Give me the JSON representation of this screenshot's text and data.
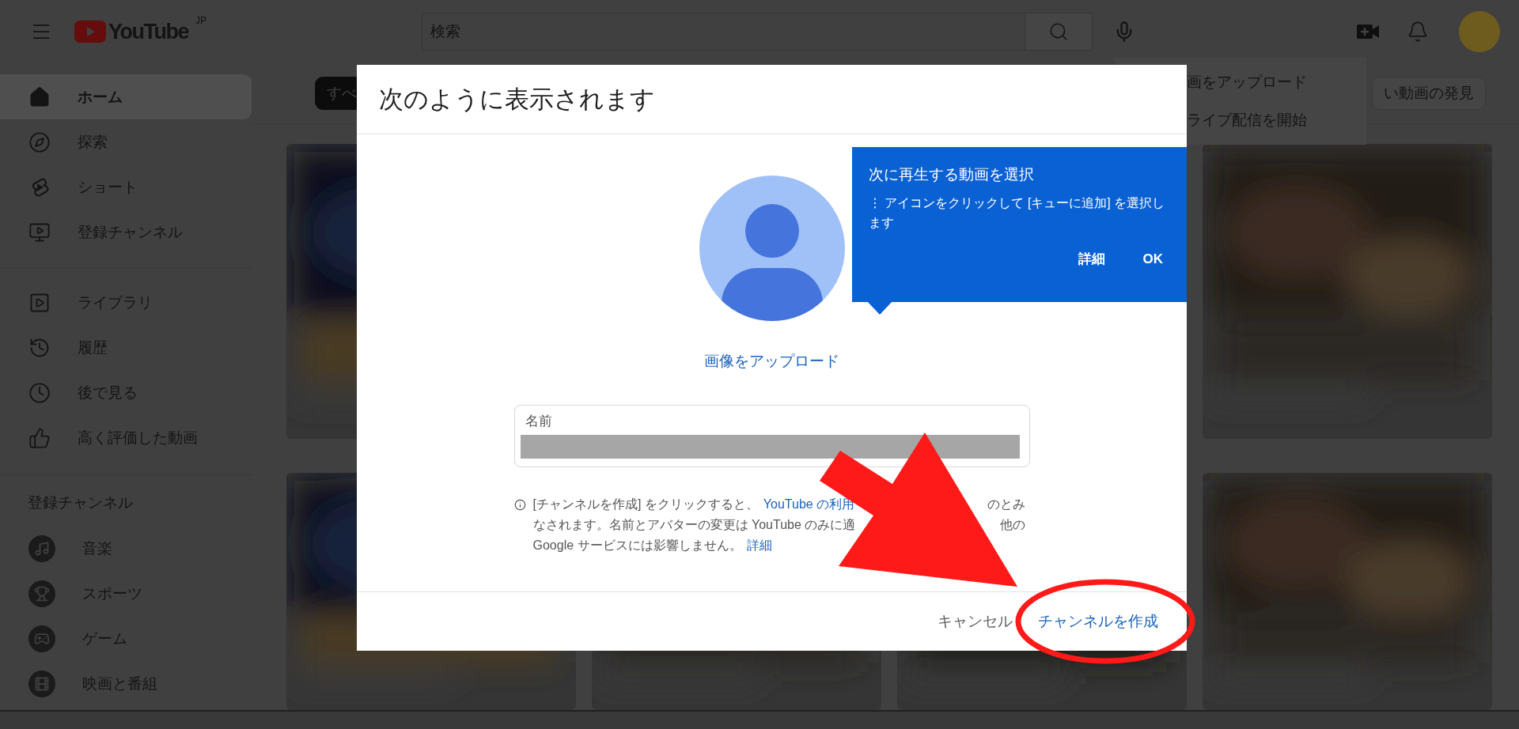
{
  "masthead": {
    "logo": "YouTube",
    "region": "JP",
    "search_placeholder": "検索"
  },
  "sidebar": {
    "sections": [
      {
        "items": [
          {
            "label": "ホーム",
            "selected": true
          },
          {
            "label": "探索",
            "selected": false
          },
          {
            "label": "ショート",
            "selected": false
          },
          {
            "label": "登録チャンネル",
            "selected": false
          }
        ]
      },
      {
        "items": [
          {
            "label": "ライブラリ",
            "selected": false
          },
          {
            "label": "履歴",
            "selected": false
          },
          {
            "label": "後で見る",
            "selected": false
          },
          {
            "label": "高く評価した動画",
            "selected": false
          }
        ]
      }
    ],
    "subscriptions": {
      "title": "登録チャンネル",
      "items": [
        {
          "label": "音楽",
          "selected": false
        },
        {
          "label": "スポーツ",
          "selected": false
        },
        {
          "label": "ゲーム",
          "selected": false
        },
        {
          "label": "映画と番組",
          "selected": false
        }
      ]
    }
  },
  "create_menu": {
    "items": [
      "画をアップロード",
      "ライブ配信を開始"
    ]
  },
  "chips": [
    {
      "label": "すべ",
      "selected": true
    },
    {
      "label": "い動画の発見",
      "selected": false
    }
  ],
  "dialog": {
    "title": "次のように表示されます",
    "upload_link": "画像をアップロード",
    "name_field": {
      "label": "名前"
    },
    "notice": [
      [
        {
          "kind": "text",
          "text": "[チャンネルを作成] をクリックすると、"
        },
        {
          "kind": "link",
          "text": "YouTube の利用"
        },
        {
          "kind": "covered"
        },
        {
          "kind": "text",
          "text": "のとみ"
        }
      ],
      [
        {
          "kind": "text",
          "text": "なされます。名前とアバターの変更は YouTube のみに適"
        },
        {
          "kind": "covered"
        },
        {
          "kind": "text",
          "text": "他の"
        }
      ],
      [
        {
          "kind": "text",
          "text": "Google サービスには影響しません。"
        },
        {
          "kind": "link",
          "text": "詳細"
        }
      ]
    ],
    "buttons": [
      {
        "label": "キャンセル",
        "primary": false
      },
      {
        "label": "チャンネルを作成",
        "primary": true
      }
    ]
  },
  "tooltip": {
    "title": "次に再生する動画を選択",
    "body": "⋮ アイコンをクリックして [キューに追加] を選択します",
    "actions": [
      "詳細",
      "OK"
    ]
  }
}
